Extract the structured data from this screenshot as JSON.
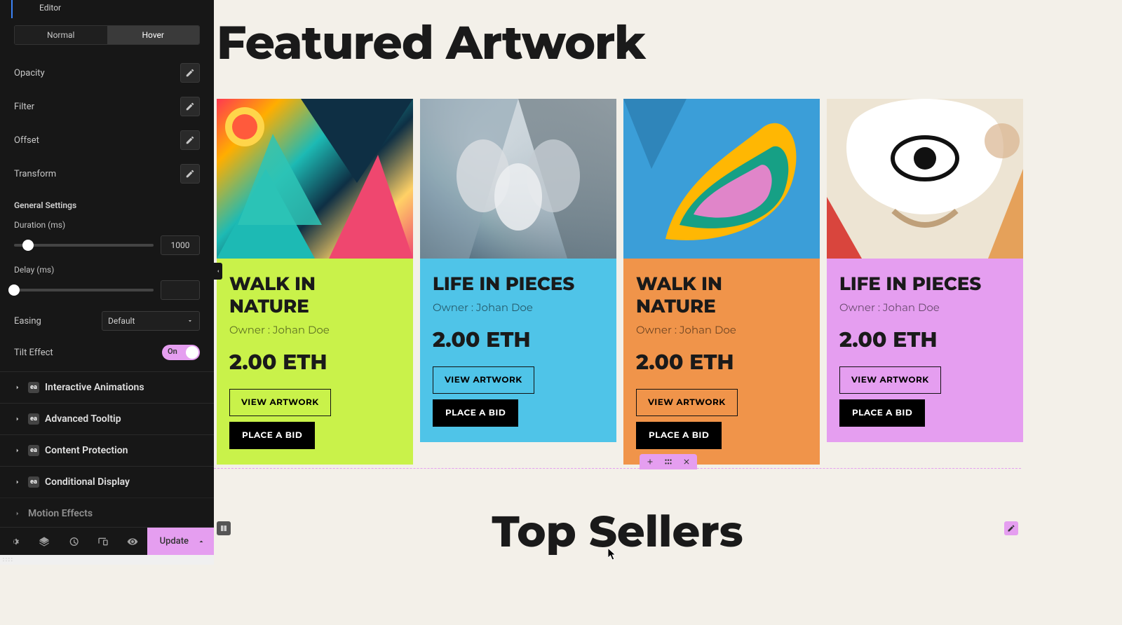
{
  "sidebar": {
    "breadcrumb_partial": "Editor",
    "tabs": {
      "normal": "Normal",
      "hover": "Hover"
    },
    "props": {
      "opacity": "Opacity",
      "filter": "Filter",
      "offset": "Offset",
      "transform": "Transform"
    },
    "general_settings_label": "General Settings",
    "duration_label": "Duration (ms)",
    "duration_value": "1000",
    "delay_label": "Delay (ms)",
    "delay_value": "",
    "easing_label": "Easing",
    "easing_value": "Default",
    "tilt_label": "Tilt Effect",
    "tilt_on_label": "On",
    "accordions": {
      "interactive_animations": "Interactive Animations",
      "advanced_tooltip": "Advanced Tooltip",
      "content_protection": "Content Protection",
      "conditional_display": "Conditional Display",
      "motion_effects": "Motion Effects"
    },
    "update_label": "Update"
  },
  "canvas": {
    "featured_title": "Featured Artwork",
    "top_sellers_title": "Top Sellers",
    "cards": [
      {
        "title": "WALK IN NATURE",
        "owner": "Owner : Johan Doe",
        "price": "2.00 ETH",
        "view": "VIEW ARTWORK",
        "bid": "PLACE A BID"
      },
      {
        "title": "LIFE IN PIECES",
        "owner": "Owner : Johan Doe",
        "price": "2.00 ETH",
        "view": "VIEW ARTWORK",
        "bid": "PLACE A BID"
      },
      {
        "title": "WALK IN NATURE",
        "owner": "Owner : Johan Doe",
        "price": "2.00 ETH",
        "view": "VIEW ARTWORK",
        "bid": "PLACE A BID"
      },
      {
        "title": "LIFE IN PIECES",
        "owner": "Owner : Johan Doe",
        "price": "2.00 ETH",
        "view": "VIEW ARTWORK",
        "bid": "PLACE A BID"
      }
    ]
  }
}
